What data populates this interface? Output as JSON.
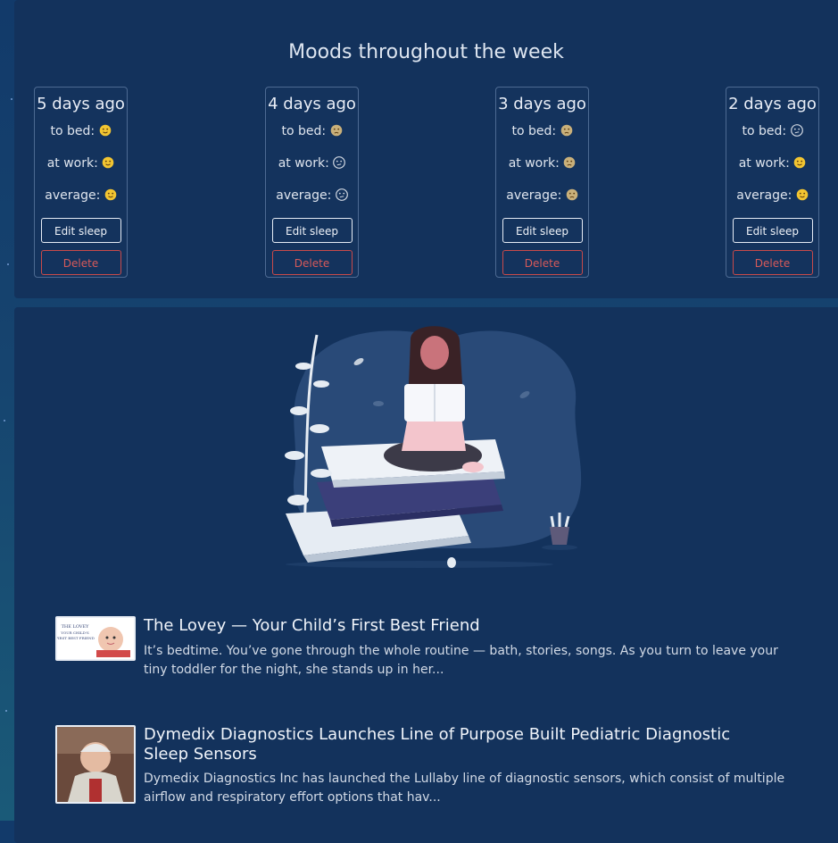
{
  "moods": {
    "title": "Moods throughout the week",
    "labels": {
      "to_bed": "to bed:",
      "at_work": "at work:",
      "average": "average:"
    },
    "buttons": {
      "edit": "Edit sleep",
      "delete": "Delete"
    },
    "days": [
      {
        "label": "5 days ago",
        "to_bed": "happy",
        "at_work": "happy",
        "average": "happy"
      },
      {
        "label": "4 days ago",
        "to_bed": "sad",
        "at_work": "confused",
        "average": "confused"
      },
      {
        "label": "3 days ago",
        "to_bed": "sad",
        "at_work": "sad",
        "average": "sad"
      },
      {
        "label": "2 days ago",
        "to_bed": "confused",
        "at_work": "happy",
        "average": "happy"
      }
    ]
  },
  "articles": [
    {
      "title": "The Lovey — Your Child’s First Best Friend",
      "excerpt": "It’s bedtime. You’ve gone through the whole routine — bath, stories, songs. As you turn to leave your tiny toddler for the night, she stands up in her...",
      "thumb_icon": "lovey-baby-thumbnail",
      "thumb_caption": "THE LOVEY YOUR CHILD'S FIRST BEST FRIEND"
    },
    {
      "title": "Dymedix Diagnostics Launches Line of Purpose Built Pediatric Diagnostic Sleep Sensors",
      "excerpt": "Dymedix Diagnostics Inc has launched the Lullaby line of diagnostic sensors, which consist of multiple airflow and respiratory effort options that hav...",
      "thumb_icon": "portrait-thumbnail"
    }
  ],
  "colors": {
    "background": "#123a6a",
    "panel": "#13325c",
    "delete": "#d85a5a",
    "emoji_yellow": "#f2c531",
    "emoji_muted": "#c9b07a"
  }
}
